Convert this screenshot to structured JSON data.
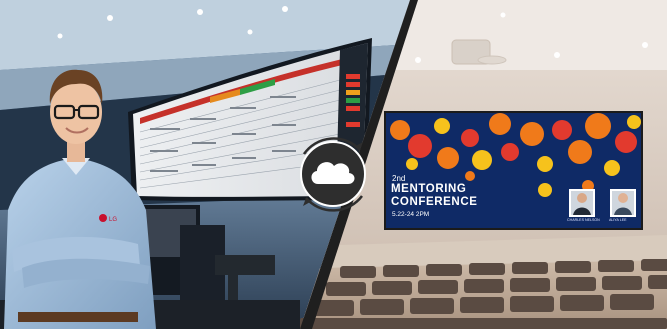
{
  "scenes": {
    "left": "control-room",
    "right": "conference-hall"
  },
  "brand_badge": "LG",
  "presentation": {
    "kicker": "2nd",
    "title_line_1": "MENTORING",
    "title_line_2": "CONFERENCE",
    "date": "5.22-24 2PM",
    "speakers": [
      {
        "caption": "CHARLES NELSON"
      },
      {
        "caption": "ALIYA LEE"
      }
    ]
  },
  "icons": {
    "center": "cloud-sync-icon"
  },
  "colors": {
    "slide_background": "#0f2a66",
    "slide_accent_orange": "#f07a1a",
    "slide_accent_yellow": "#f6c21c",
    "slide_accent_red": "#e23a2e",
    "cloud_badge": "#2e2e2e",
    "divider": "#1f1f1f"
  }
}
